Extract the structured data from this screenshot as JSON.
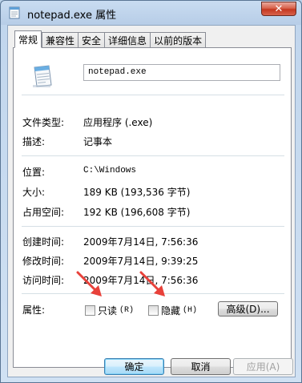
{
  "window": {
    "title": "notepad.exe 属性",
    "close_label": "✕"
  },
  "tabs": [
    {
      "label": "常规",
      "active": true
    },
    {
      "label": "兼容性",
      "active": false
    },
    {
      "label": "安全",
      "active": false
    },
    {
      "label": "详细信息",
      "active": false
    },
    {
      "label": "以前的版本",
      "active": false
    }
  ],
  "general": {
    "file_name": "notepad.exe",
    "type_label": "文件类型:",
    "type_value": "应用程序 (.exe)",
    "desc_label": "描述:",
    "desc_value": "记事本",
    "location_label": "位置:",
    "location_value": "C:\\Windows",
    "size_label": "大小:",
    "size_value": "189 KB (193,536 字节)",
    "disk_size_label": "占用空间:",
    "disk_size_value": "192 KB (196,608 字节)",
    "created_label": "创建时间:",
    "created_value": "2009年7月14日, 7:56:36",
    "modified_label": "修改时间:",
    "modified_value": "2009年7月14日, 9:39:25",
    "accessed_label": "访问时间:",
    "accessed_value": "2009年7月14日, 7:56:36",
    "attributes_label": "属性:",
    "readonly_label": "只读",
    "readonly_key": "(R)",
    "readonly_checked": false,
    "hidden_label": "隐藏",
    "hidden_key": "(H)",
    "hidden_checked": false,
    "advanced_label": "高级(D)..."
  },
  "footer": {
    "ok_label": "确定",
    "cancel_label": "取消",
    "apply_label": "应用(A)"
  },
  "colors": {
    "annotation_arrow": "#e8413a",
    "title_bar": "#c9dcf1",
    "close_button": "#c4371f"
  },
  "icons": {
    "app": "notepad-icon",
    "file": "notepad-file-icon"
  }
}
